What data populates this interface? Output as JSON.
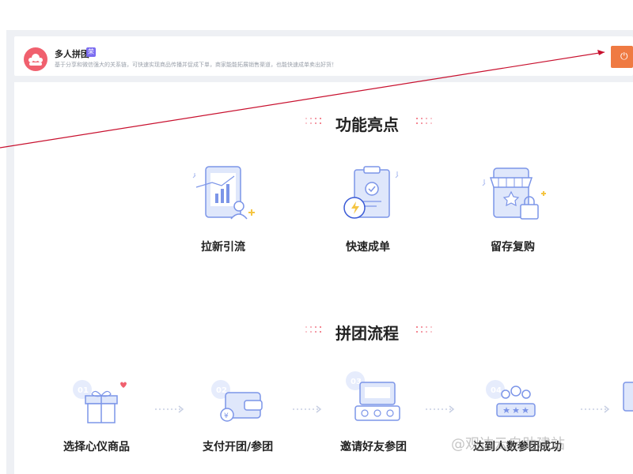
{
  "app": {
    "title": "多人拼团",
    "badge": "荣",
    "description": "基于分享和微信强大的关系链，可快速实现商品传播并促成下单，商家能能拓展销售渠道，也能快速成单卖出好货！",
    "power_icon": "power-icon"
  },
  "sections": {
    "highlights": {
      "title": "功能亮点",
      "items": [
        {
          "label": "拉新引流",
          "icon": "tablet-chart-user-icon"
        },
        {
          "label": "快速成单",
          "icon": "clipboard-check-icon"
        },
        {
          "label": "留存复购",
          "icon": "storefront-shopping-icon"
        }
      ]
    },
    "process": {
      "title": "拼团流程",
      "steps": [
        {
          "label": "选择心仪商品",
          "number": "01",
          "icon": "gift-box-icon"
        },
        {
          "label": "支付开团/参团",
          "number": "02",
          "icon": "wallet-payment-icon"
        },
        {
          "label": "邀请好友参团",
          "number": "03",
          "icon": "invite-screen-icon"
        },
        {
          "label": "达到人数参团成功",
          "number": "04",
          "icon": "group-users-icon"
        }
      ]
    }
  },
  "watermark": "@观达云自助建站",
  "colors": {
    "accent_pink": "#f0606e",
    "badge_purple": "#7b6cf0",
    "power_orange": "#ef7a42",
    "illus_blue": "#7c95e8",
    "illus_light": "#dfe7fb",
    "annotation_red": "#c8102e"
  }
}
